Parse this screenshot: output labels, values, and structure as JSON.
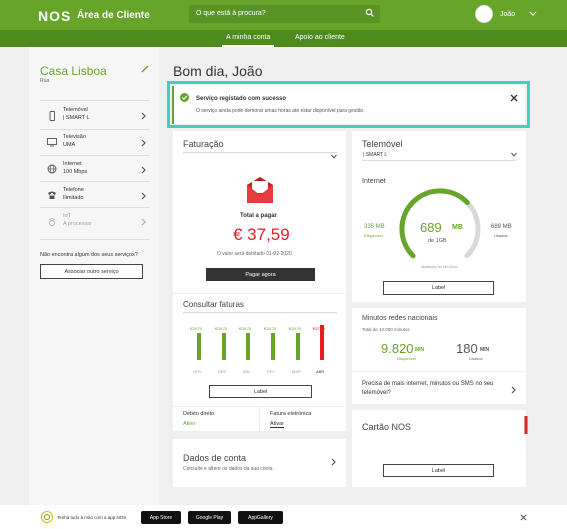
{
  "header": {
    "logo": "NOS",
    "app_title": "Área de Cliente",
    "search_placeholder": "O que está à procura?",
    "username": "João",
    "icons": {
      "search": "search-icon",
      "user_menu": "chevron-down-icon"
    }
  },
  "nav": {
    "tabs": [
      {
        "label": "A minha conta",
        "active": true
      },
      {
        "label": "Apoio ao cliente",
        "active": false
      }
    ]
  },
  "sidebar": {
    "home_title": "Casa Lisboa",
    "home_subtitle": "Rua",
    "services": [
      {
        "title": "Telemóvel",
        "subtitle": "| SMART L",
        "icon": "phone-icon"
      },
      {
        "title": "Televisão",
        "subtitle": "UMA",
        "icon": "tv-icon"
      },
      {
        "title": "Internet",
        "subtitle": "100 Mbps",
        "icon": "globe-icon"
      },
      {
        "title": "Telefone",
        "subtitle": "Ilimitado",
        "icon": "telephone-icon"
      },
      {
        "title": "IoT",
        "subtitle": "A processar",
        "icon": "iot-icon"
      }
    ],
    "missing_question": "Não encontra algum dos seus serviços?",
    "associate_button": "Associar outro serviço"
  },
  "greeting": "Bom dia, João",
  "alert": {
    "title": "Serviço registado com sucesso",
    "text": "O serviço ainda pode demorar umas horas até estar disponível para gestão."
  },
  "billing": {
    "title": "Faturação",
    "total_label": "Total a pagar",
    "amount": "€ 37,59",
    "debit_note": "O valor será debitado 01-02-2020",
    "pay_button": "Pagar agora"
  },
  "invoices": {
    "title": "Consultar faturas",
    "label_button": "Label",
    "months": [
      "NOV",
      "DEZ",
      "JAN",
      "FEV",
      "MAR",
      "ABR"
    ],
    "labels": [
      "€28,70",
      "€28,70",
      "€28,70",
      "€28,70",
      "€28,70",
      "€37,59"
    ],
    "values": [
      28.7,
      28.7,
      28.7,
      28.7,
      28.7,
      37.59
    ],
    "colors": [
      "#66a52a",
      "#66a52a",
      "#66a52a",
      "#66a52a",
      "#66a52a",
      "#e31e24"
    ]
  },
  "direct_debit": {
    "title": "Debito direto",
    "value": "Ativo"
  },
  "e_invoice": {
    "title": "Fatura eletrónica",
    "value": "Ativar"
  },
  "account": {
    "title": "Dados de conta",
    "subtitle": "Consulte e altere os dados da sua conta"
  },
  "mobile": {
    "title": "Telemóvel",
    "number": "| SMART L",
    "internet_title": "Internet",
    "used_value": "335 MB",
    "used_label": "Disponível",
    "free_value": "689 MB",
    "free_label": "Usados",
    "gauge_value": "689",
    "gauge_unit": "MB",
    "gauge_total": "de 1GB",
    "gauge_fraction": 0.67,
    "updated": "atualizado às 14h13min",
    "label_button": "Label"
  },
  "minutes": {
    "title": "Minutos redes nacionais",
    "subtitle": "Total de 10.000 minutos",
    "available_value": "9.820",
    "available_unit": "MIN",
    "available_label": "Disponível",
    "used_value": "180",
    "used_unit": "MIN",
    "used_label": "Usados"
  },
  "more_offer": "Precisa de mais internet, minutos ou SMS no seu telemóvel?",
  "nos_card": {
    "title": "Cartão NOS",
    "label_button": "Label"
  },
  "footer": {
    "text": "Tenha tudo à mão com a app NOS",
    "stores": [
      "App Store",
      "Google Play",
      "AppGallery"
    ]
  },
  "colors": {
    "brand_green": "#66a52a",
    "nav_green": "#4f8a1f",
    "alert_border": "#3fd2bb",
    "red": "#e31e24"
  }
}
